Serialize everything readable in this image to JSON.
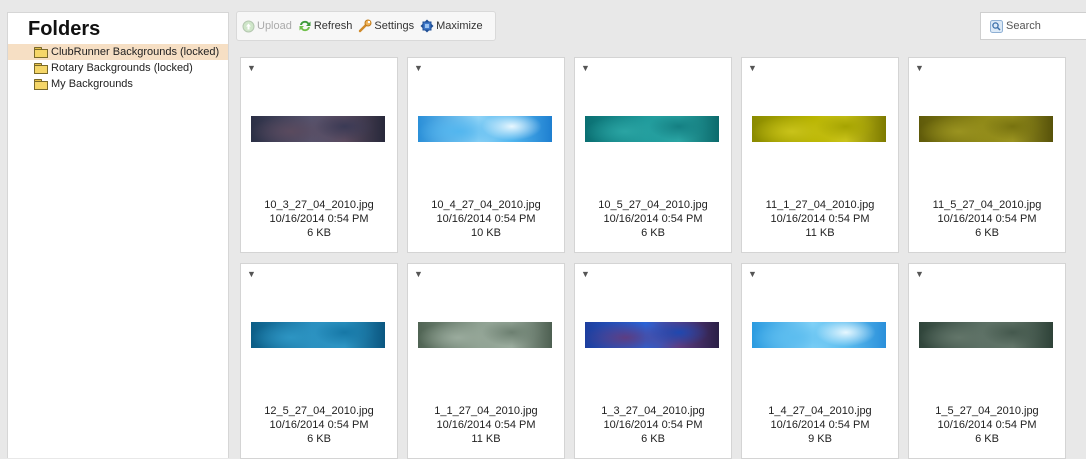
{
  "folders_panel": {
    "title": "Folders",
    "items": [
      {
        "label": "ClubRunner Backgrounds (locked)",
        "selected": true
      },
      {
        "label": "Rotary Backgrounds (locked)",
        "selected": false
      },
      {
        "label": "My Backgrounds",
        "selected": false
      }
    ]
  },
  "toolbar": {
    "upload_label": "Upload",
    "refresh_label": "Refresh",
    "settings_label": "Settings",
    "maximize_label": "Maximize",
    "search_label": "Search"
  },
  "files": [
    {
      "name": "10_3_27_04_2010.jpg",
      "date": "10/16/2014 0:54 PM",
      "size": "6 KB",
      "thumb": [
        "#2b2f45",
        "#56536d",
        "#3a3a55",
        "#5a4a5e",
        "#27283a"
      ]
    },
    {
      "name": "10_4_27_04_2010.jpg",
      "date": "10/16/2014 0:54 PM",
      "size": "10 KB",
      "thumb": [
        "#2a8fd8",
        "#8fd3f6",
        "#e8f7ff",
        "#52b6ef",
        "#1e7fd0"
      ]
    },
    {
      "name": "10_5_27_04_2010.jpg",
      "date": "10/16/2014 0:54 PM",
      "size": "6 KB",
      "thumb": [
        "#0a6f72",
        "#1f9a9b",
        "#147f82",
        "#2aa4a3",
        "#0c6a6c"
      ]
    },
    {
      "name": "11_1_27_04_2010.jpg",
      "date": "10/16/2014 0:54 PM",
      "size": "11 KB",
      "thumb": [
        "#8a8a00",
        "#b8b400",
        "#a5a300",
        "#c9c31a",
        "#7d7a00"
      ]
    },
    {
      "name": "11_5_27_04_2010.jpg",
      "date": "10/16/2014 0:54 PM",
      "size": "6 KB",
      "thumb": [
        "#5f5a0a",
        "#8d8716",
        "#77720f",
        "#9a9320",
        "#57520a"
      ]
    },
    {
      "name": "12_5_27_04_2010.jpg",
      "date": "10/16/2014 0:54 PM",
      "size": "6 KB",
      "thumb": [
        "#0b5d86",
        "#2a8fbf",
        "#1677a6",
        "#2d95c3",
        "#0a5680"
      ]
    },
    {
      "name": "1_1_27_04_2010.jpg",
      "date": "10/16/2014 0:54 PM",
      "size": "11 KB",
      "thumb": [
        "#4f6353",
        "#8ea091",
        "#6c7f70",
        "#9aab9d",
        "#4d5f51"
      ]
    },
    {
      "name": "1_3_27_04_2010.jpg",
      "date": "10/16/2014 0:54 PM",
      "size": "6 KB",
      "thumb": [
        "#1d3e9e",
        "#2a63d6",
        "#1e48b0",
        "#5d3d82",
        "#2a1f46"
      ]
    },
    {
      "name": "1_4_27_04_2010.jpg",
      "date": "10/16/2014 0:54 PM",
      "size": "9 KB",
      "thumb": [
        "#2b9be0",
        "#7fd0f6",
        "#e6f7ff",
        "#5cbdef",
        "#2a8fda"
      ]
    },
    {
      "name": "1_5_27_04_2010.jpg",
      "date": "10/16/2014 0:54 PM",
      "size": "6 KB",
      "thumb": [
        "#2f443a",
        "#5a6e63",
        "#44584d",
        "#627569",
        "#2e4238"
      ]
    }
  ]
}
